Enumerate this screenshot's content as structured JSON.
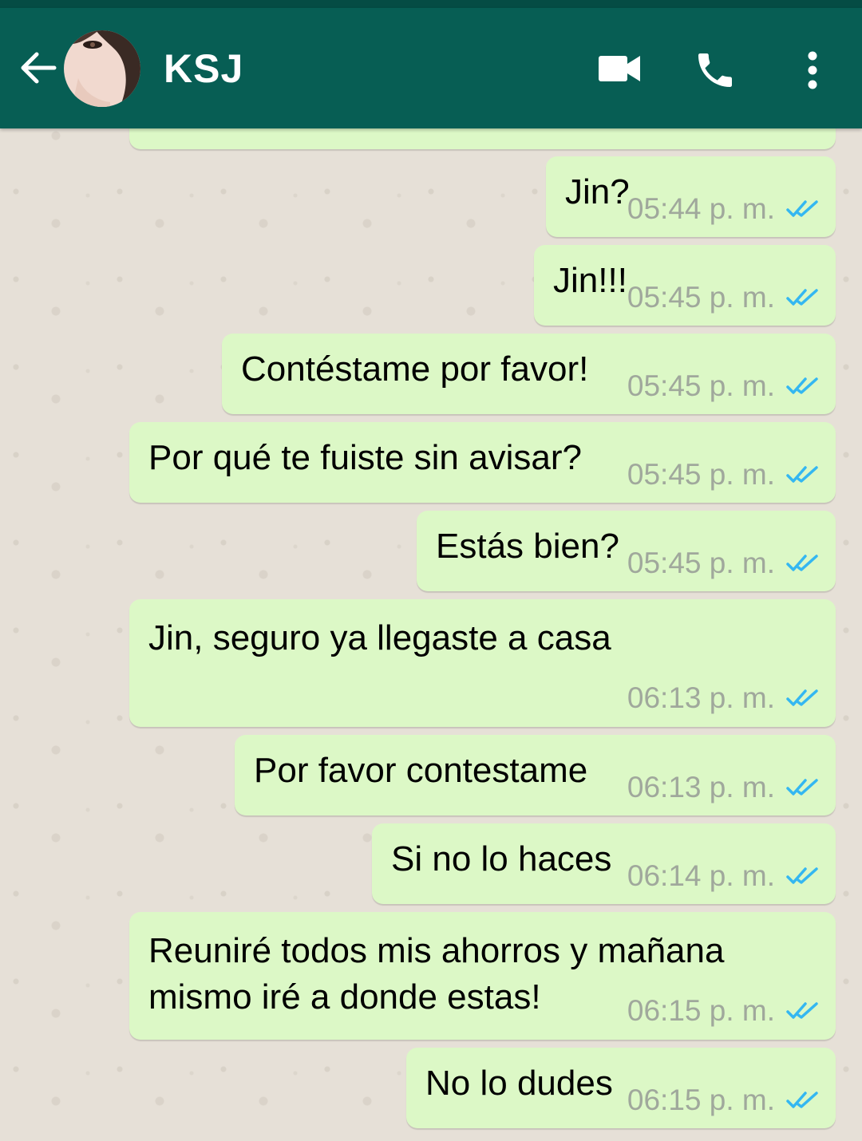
{
  "header": {
    "contact_name": "KSJ"
  },
  "icons": {
    "back": "arrow-left-icon",
    "video": "video-camera-icon",
    "call": "phone-icon",
    "menu": "more-vertical-icon",
    "read_receipt": "double-check-icon"
  },
  "colors": {
    "header": "#075e54",
    "outgoing_bubble": "#dcf8c6",
    "read_tick": "#34b7f1",
    "chat_background": "#e6e0d7"
  },
  "messages": [
    {
      "text": "",
      "time": ""
    },
    {
      "text": "Jin?",
      "time": "05:44 p. m."
    },
    {
      "text": "Jin!!!",
      "time": "05:45 p. m."
    },
    {
      "text": "Contéstame por favor!",
      "time": "05:45 p. m."
    },
    {
      "text": "Por qué te fuiste sin avisar?",
      "time": "05:45 p. m."
    },
    {
      "text": "Estás bien?",
      "time": "05:45 p. m."
    },
    {
      "text": "Jin, seguro ya llegaste a casa",
      "time": "06:13 p. m."
    },
    {
      "text": "Por favor contestame",
      "time": "06:13 p. m."
    },
    {
      "text": "Si no lo haces",
      "time": "06:14 p. m."
    },
    {
      "text": "Reuniré todos mis ahorros y mañana",
      "text2": "mismo iré a donde estas!",
      "time": "06:15 p. m."
    },
    {
      "text": "No lo dudes",
      "time": "06:15 p. m."
    }
  ]
}
